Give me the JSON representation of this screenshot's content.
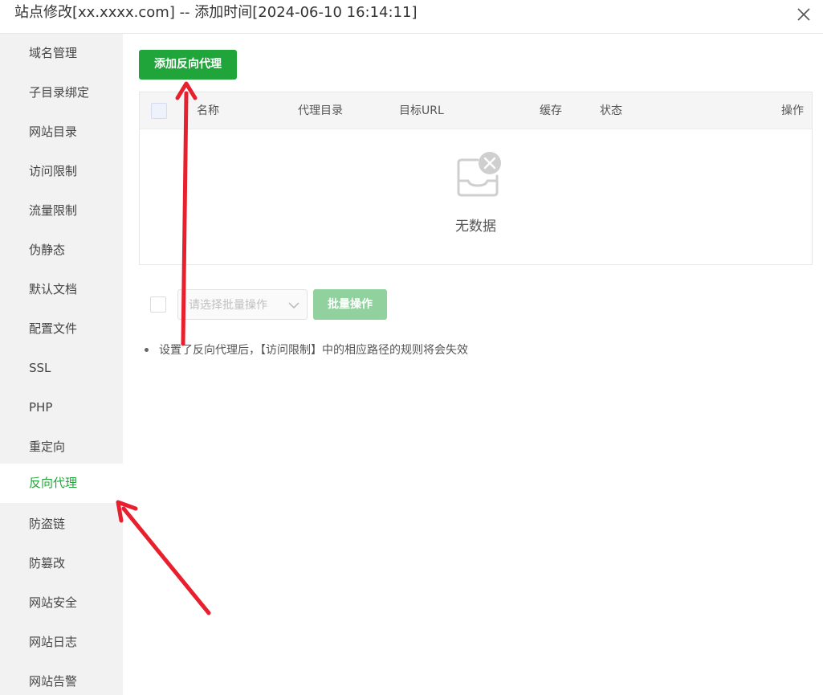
{
  "dialog": {
    "title": "站点修改[xx.xxxx.com] -- 添加时间[2024-06-10 16:14:11]",
    "close_icon": "close-icon"
  },
  "sidebar": {
    "items": [
      {
        "label": "域名管理"
      },
      {
        "label": "子目录绑定"
      },
      {
        "label": "网站目录"
      },
      {
        "label": "访问限制"
      },
      {
        "label": "流量限制"
      },
      {
        "label": "伪静态"
      },
      {
        "label": "默认文档"
      },
      {
        "label": "配置文件"
      },
      {
        "label": "SSL"
      },
      {
        "label": "PHP"
      },
      {
        "label": "重定向"
      },
      {
        "label": "反向代理"
      },
      {
        "label": "防盗链"
      },
      {
        "label": "防篡改"
      },
      {
        "label": "网站安全"
      },
      {
        "label": "网站日志"
      },
      {
        "label": "网站告警"
      }
    ],
    "active": "反向代理"
  },
  "main": {
    "add_button": "添加反向代理",
    "table": {
      "columns": [
        "名称",
        "代理目录",
        "目标URL",
        "缓存",
        "状态",
        "操作"
      ],
      "rows": [],
      "empty_text": "无数据",
      "empty_icon": "empty-inbox-icon"
    },
    "batch": {
      "select_placeholder": "请选择批量操作",
      "button": "批量操作"
    },
    "note": "设置了反向代理后，【访问限制】中的相应路径的规则将会失效"
  },
  "colors": {
    "accent": "#20a53a",
    "accent_disabled": "#90d19e",
    "annotation_arrow": "#e8202e"
  }
}
